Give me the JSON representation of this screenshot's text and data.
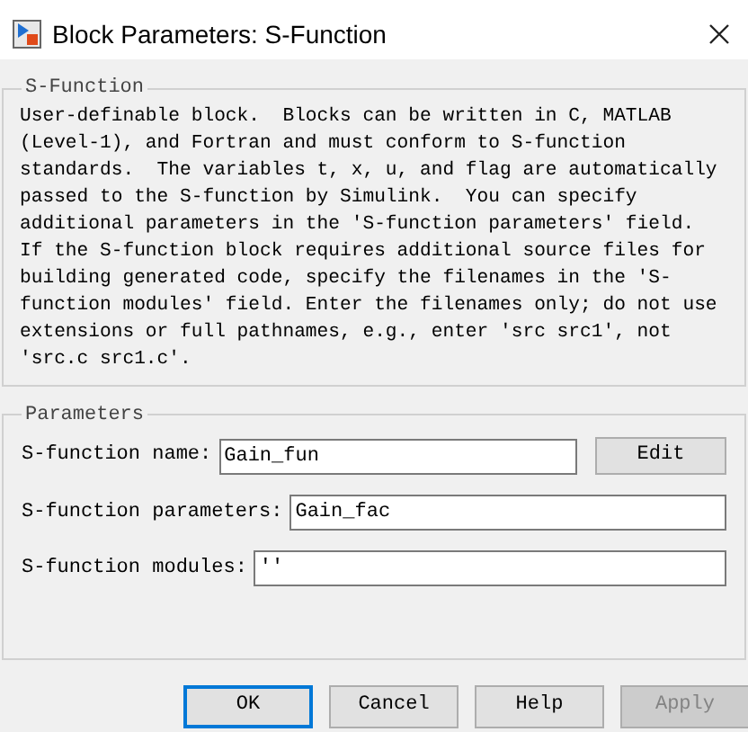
{
  "window": {
    "title": "Block Parameters: S-Function"
  },
  "description_group": {
    "title": "S-Function",
    "text": "User-definable block.  Blocks can be written in C, MATLAB (Level-1), and Fortran and must conform to S-function standards.  The variables t, x, u, and flag are automatically passed to the S-function by Simulink.  You can specify additional parameters in the 'S-function parameters' field. If the S-function block requires additional source files for building generated code, specify the filenames in the 'S-function modules' field. Enter the filenames only; do not use extensions or full pathnames, e.g., enter 'src src1', not 'src.c src1.c'."
  },
  "parameters_group": {
    "title": "Parameters",
    "fields": [
      {
        "label": "S-function name:",
        "value": "Gain_fun",
        "button": "Edit"
      },
      {
        "label": "S-function parameters:",
        "value": "Gain_fac"
      },
      {
        "label": "S-function modules:",
        "value": "''"
      }
    ]
  },
  "buttons": [
    {
      "label": "OK",
      "focused": true,
      "disabled": false
    },
    {
      "label": "Cancel",
      "focused": false,
      "disabled": false
    },
    {
      "label": "Help",
      "focused": false,
      "disabled": false
    },
    {
      "label": "Apply",
      "focused": false,
      "disabled": true
    }
  ]
}
